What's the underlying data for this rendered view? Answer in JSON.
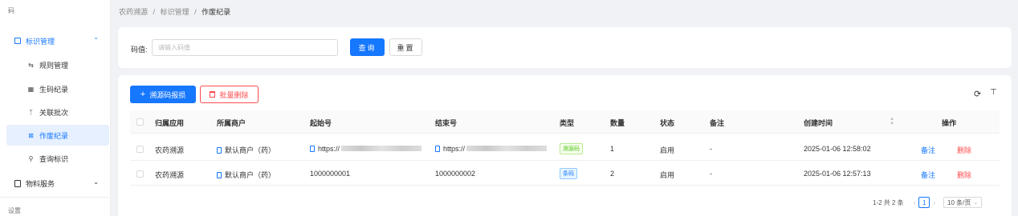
{
  "sidebar": {
    "top_label": "码",
    "group": {
      "label": "标识管理",
      "expanded": true
    },
    "items": [
      {
        "label": "规则管理",
        "icon": "swap-icon"
      },
      {
        "label": "生码纪录",
        "icon": "barcode-icon"
      },
      {
        "label": "关联批次",
        "icon": "branch-icon"
      },
      {
        "label": "作废纪录",
        "icon": "void-icon",
        "active": true
      },
      {
        "label": "查询标识",
        "icon": "search-icon"
      }
    ],
    "bottom_group": {
      "label": "物料服务"
    },
    "footer_label": "设置"
  },
  "breadcrumb": [
    "农药溯源",
    "/",
    "标识管理",
    "/",
    "作废纪录"
  ],
  "search": {
    "label": "码值:",
    "placeholder": "请输入码值",
    "query_button": "查询",
    "reset_button": "重置"
  },
  "toolbar": {
    "report_button": "溯源码报损",
    "batch_delete_button": "批量删除"
  },
  "table": {
    "headers": [
      "归属应用",
      "所属商户",
      "起始号",
      "结束号",
      "类型",
      "数量",
      "状态",
      "备注",
      "创建时间",
      "操作"
    ],
    "rows": [
      {
        "app": "农药溯源",
        "merchant": "默认商户（药）",
        "start": "https://",
        "end": "https://",
        "type": "溯源码",
        "count": "1",
        "status": "启用",
        "note": "-",
        "created": "2025-01-06 12:58:02",
        "action_note": "备注",
        "action_delete": "删除"
      },
      {
        "app": "农药溯源",
        "merchant": "默认商户（药）",
        "start": "1000000001",
        "end": "1000000002",
        "type": "条码",
        "count": "2",
        "status": "启用",
        "note": "-",
        "created": "2025-01-06 12:57:13",
        "action_note": "备注",
        "action_delete": "删除"
      }
    ]
  },
  "pagination": {
    "total_text": "1-2 共 2 条",
    "current_page": "1",
    "page_size": "10 条/页"
  },
  "colors": {
    "primary": "#1677ff",
    "danger": "#ff4d4f",
    "tag_green": "#52c41a"
  }
}
